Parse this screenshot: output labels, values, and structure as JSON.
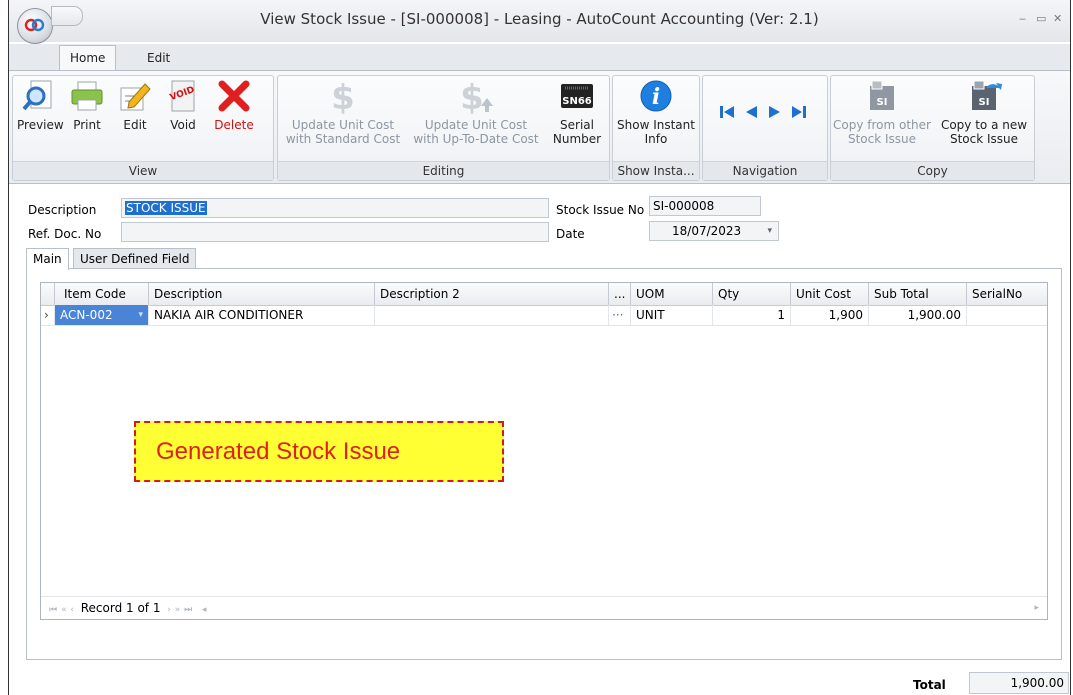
{
  "window": {
    "title": "View Stock Issue - [SI-000008] - Leasing - AutoCount Accounting (Ver: 2.1)",
    "minimize": "‒",
    "maximize": "▭",
    "close": "✕"
  },
  "ribbon_tabs": [
    "Home",
    "Edit"
  ],
  "ribbon": {
    "view_group": {
      "label": "View",
      "preview": "Preview",
      "print": "Print",
      "edit": "Edit",
      "void": "Void",
      "delete": "Delete",
      "void_badge": "VOID"
    },
    "editing_group": {
      "label": "Editing",
      "update_standard_1": "Update Unit Cost",
      "update_standard_2": "with Standard Cost",
      "update_uptodate_1": "Update Unit Cost",
      "update_uptodate_2": "with Up-To-Date Cost",
      "serial_1": "Serial",
      "serial_2": "Number",
      "serial_badge": "SN66"
    },
    "info_group": {
      "label": "Show Insta...",
      "show_1": "Show Instant",
      "show_2": "Info"
    },
    "navigation_group": {
      "label": "Navigation"
    },
    "copy_group": {
      "label": "Copy",
      "copy_from_1": "Copy from other",
      "copy_from_2": "Stock Issue",
      "copy_to_1": "Copy to a new",
      "copy_to_2": "Stock Issue",
      "si_badge": "SI"
    }
  },
  "form": {
    "description_label": "Description",
    "description_value": "STOCK ISSUE",
    "ref_doc_label": "Ref. Doc. No",
    "ref_doc_value": "",
    "stock_issue_no_label": "Stock Issue No",
    "stock_issue_no_value": "SI-000008",
    "date_label": "Date",
    "date_value": "18/07/2023"
  },
  "inner_tabs": [
    "Main",
    "User Defined Field"
  ],
  "grid": {
    "columns": [
      "Item Code",
      "Description",
      "Description 2",
      "...",
      "UOM",
      "Qty",
      "Unit Cost",
      "Sub Total",
      "SerialNo"
    ],
    "rows": [
      {
        "item_code": "ACN-002",
        "description": "NAKIA AIR CONDITIONER",
        "description2": "",
        "more": "···",
        "uom": "UNIT",
        "qty": "1",
        "unit_cost": "1,900",
        "sub_total": "1,900.00",
        "serial_no": ""
      }
    ],
    "record_text": "Record 1 of 1"
  },
  "annotation": "Generated Stock Issue",
  "footer": {
    "total_label": "Total",
    "total_value": "1,900.00"
  }
}
